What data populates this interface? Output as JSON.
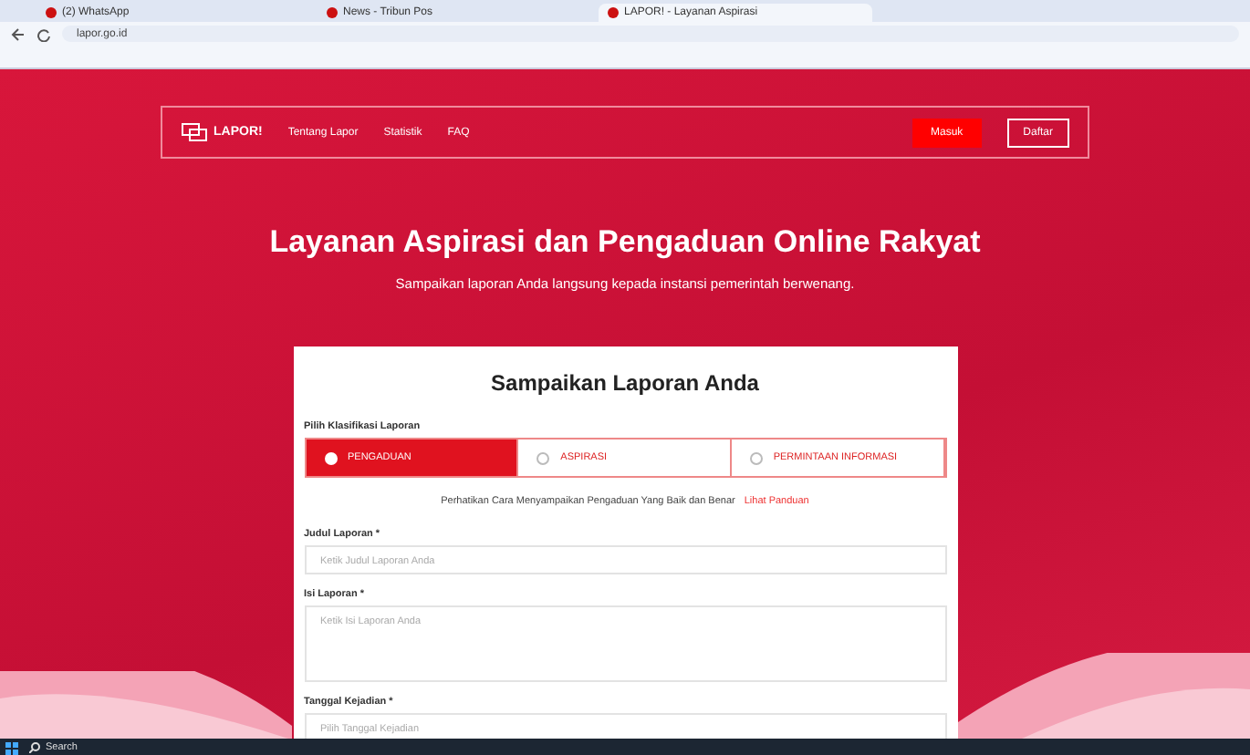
{
  "browser": {
    "tabs": [
      {
        "title": "(2) WhatsApp",
        "selected": false
      },
      {
        "title": "News - Tribun Pos",
        "selected": false
      },
      {
        "title": "LAPOR! - Layanan Aspirasi",
        "selected": true
      }
    ],
    "url": "lapor.go.id"
  },
  "navbar": {
    "logo": "LAPOR!",
    "links": [
      "Tentang Lapor",
      "Statistik",
      "FAQ"
    ],
    "login": "Masuk",
    "register": "Daftar"
  },
  "hero": {
    "title": "Layanan Aspirasi dan Pengaduan Online Rakyat",
    "subtitle": "Sampaikan laporan Anda langsung kepada instansi pemerintah berwenang."
  },
  "form": {
    "title": "Sampaikan Laporan Anda",
    "classification_label": "Pilih Klasifikasi Laporan",
    "options": [
      {
        "label": "PENGADUAN",
        "selected": true
      },
      {
        "label": "ASPIRASI",
        "selected": false
      },
      {
        "label": "PERMINTAAN INFORMASI",
        "selected": false
      }
    ],
    "notice": "Perhatikan Cara Menyampaikan Pengaduan Yang Baik dan Benar",
    "notice_link": "Lihat Panduan",
    "fields": [
      {
        "label": "Judul Laporan *",
        "placeholder": "Ketik Judul Laporan Anda",
        "kind": "input"
      },
      {
        "label": "Isi Laporan *",
        "placeholder": "Ketik Isi Laporan Anda",
        "kind": "textarea"
      },
      {
        "label": "Tanggal Kejadian *",
        "placeholder": "Pilih Tanggal Kejadian",
        "kind": "input"
      }
    ]
  },
  "taskbar": {
    "search": "Search"
  }
}
